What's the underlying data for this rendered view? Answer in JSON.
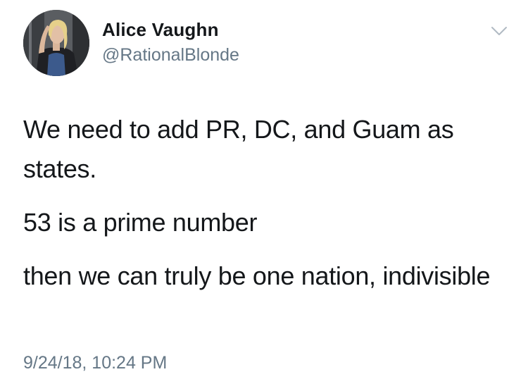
{
  "tweet": {
    "author": {
      "display_name": "Alice Vaughn",
      "handle": "@RationalBlonde",
      "avatar_icon": "profile-photo"
    },
    "paragraphs": [
      "We need to add PR, DC, and Guam as states.",
      "53 is a prime number",
      "then we can truly be one nation, indivisible"
    ],
    "timestamp": "9/24/18, 10:24 PM",
    "menu_icon": "chevron-down-icon"
  },
  "colors": {
    "text_primary": "#14171a",
    "text_secondary": "#657786",
    "chevron": "#b1bac3",
    "background": "#ffffff"
  }
}
